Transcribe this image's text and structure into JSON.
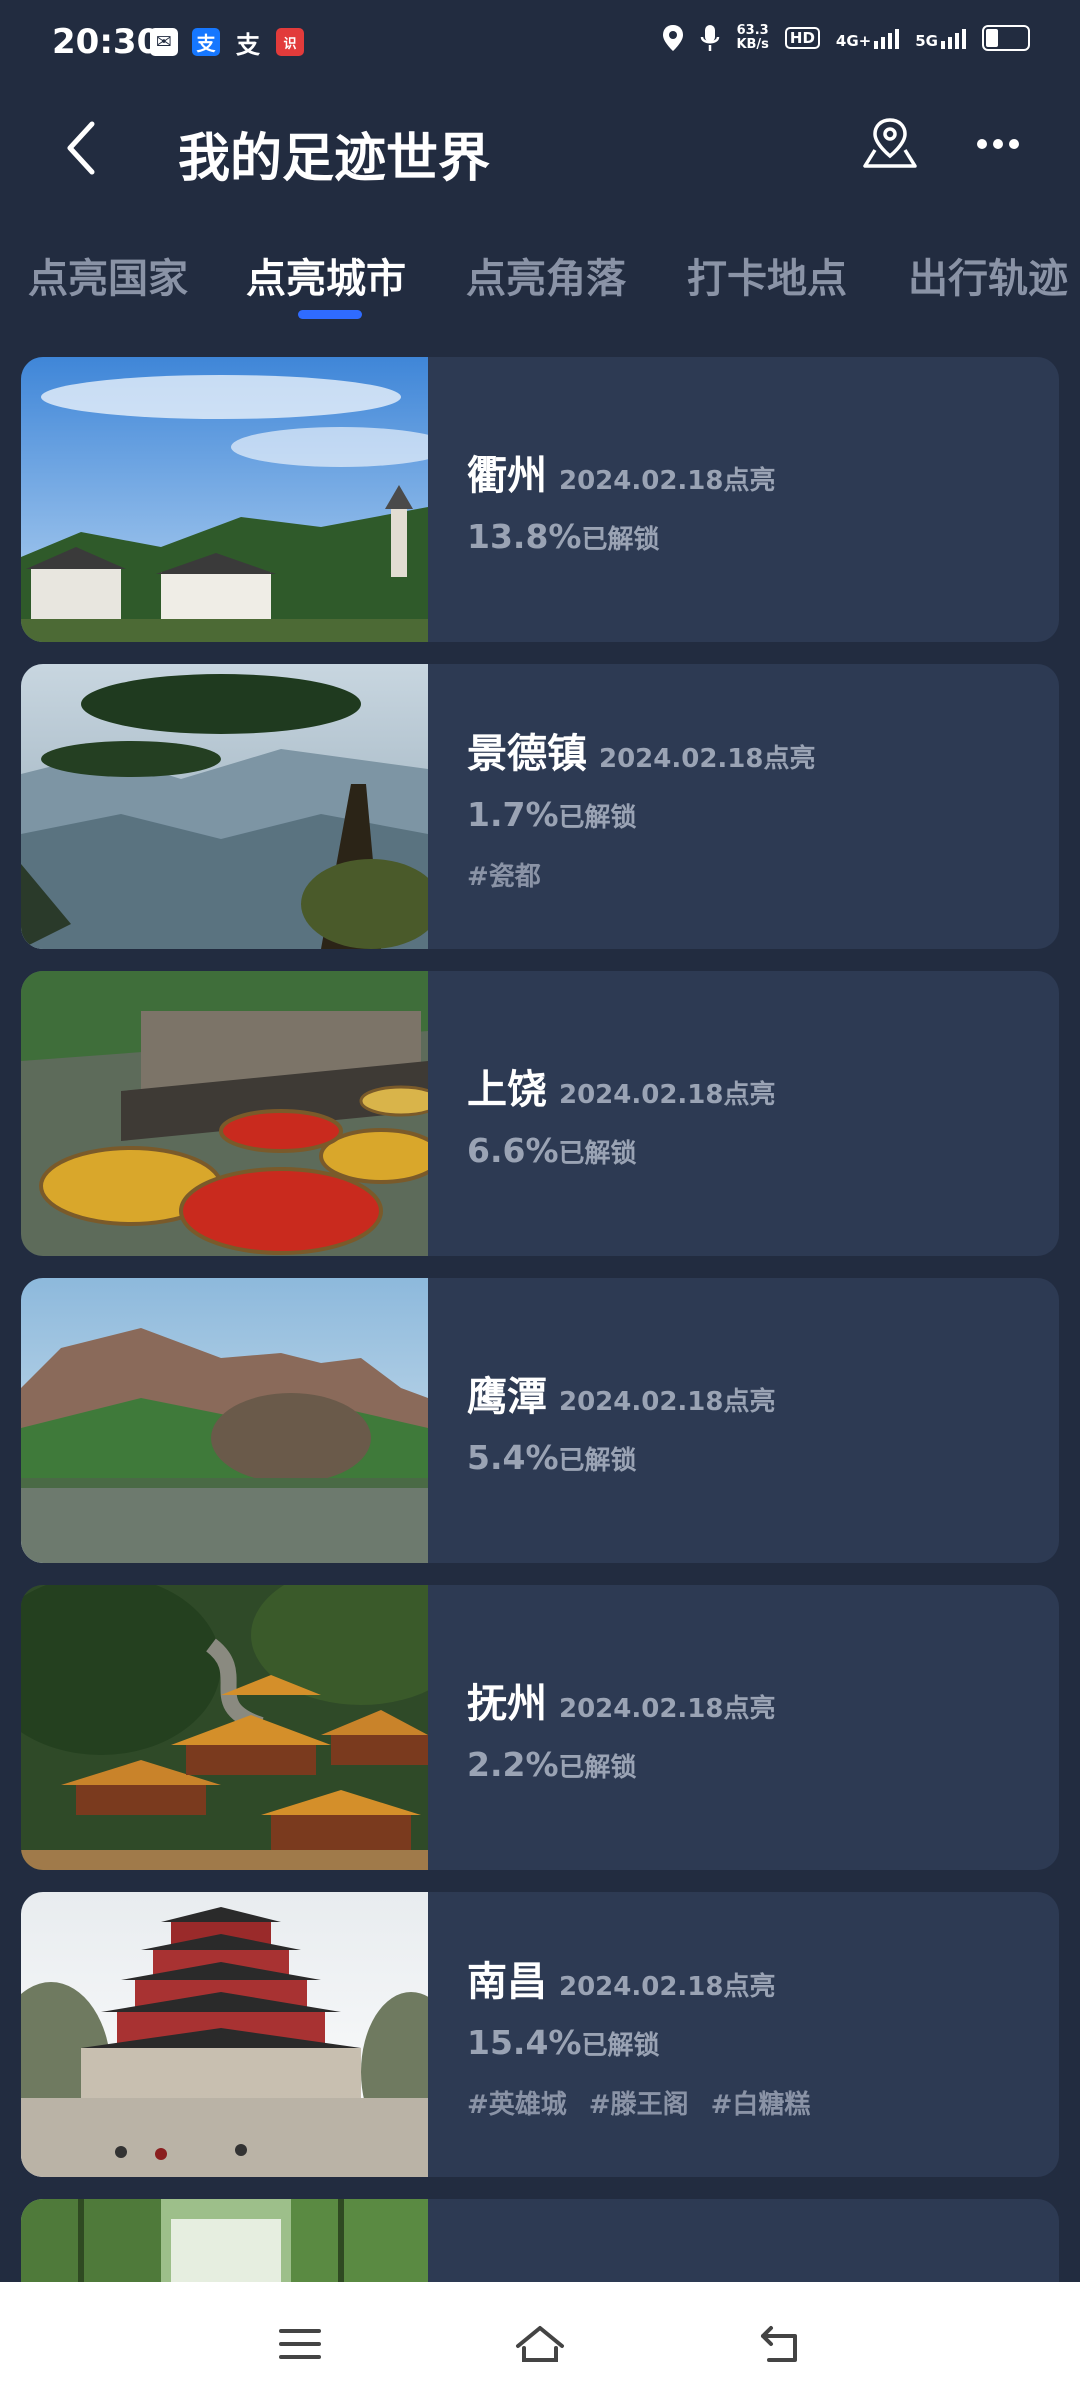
{
  "status_bar": {
    "time": "20:30",
    "notif_icons": [
      "mail-icon",
      "alipay-icon",
      "alipay-outline-icon",
      "red-app-icon"
    ],
    "notif_red_label": "识",
    "network_speed_value": "63.3",
    "network_speed_unit": "KB/s",
    "hd_label": "HD",
    "net1_label": "4G+",
    "net2_label": "5G"
  },
  "header": {
    "title": "我的足迹世界"
  },
  "tabs": [
    {
      "label": "点亮国家",
      "active": false
    },
    {
      "label": "点亮城市",
      "active": true
    },
    {
      "label": "点亮角落",
      "active": false
    },
    {
      "label": "打卡地点",
      "active": false
    },
    {
      "label": "出行轨迹",
      "active": false
    }
  ],
  "cities": [
    {
      "name": "衢州",
      "date": "2024.02.18点亮",
      "percent": "13.8%",
      "unlocked_label": "已解锁",
      "tags": []
    },
    {
      "name": "景德镇",
      "date": "2024.02.18点亮",
      "percent": "1.7%",
      "unlocked_label": "已解锁",
      "tags": [
        "#瓷都"
      ]
    },
    {
      "name": "上饶",
      "date": "2024.02.18点亮",
      "percent": "6.6%",
      "unlocked_label": "已解锁",
      "tags": []
    },
    {
      "name": "鹰潭",
      "date": "2024.02.18点亮",
      "percent": "5.4%",
      "unlocked_label": "已解锁",
      "tags": []
    },
    {
      "name": "抚州",
      "date": "2024.02.18点亮",
      "percent": "2.2%",
      "unlocked_label": "已解锁",
      "tags": []
    },
    {
      "name": "南昌",
      "date": "2024.02.18点亮",
      "percent": "15.4%",
      "unlocked_label": "已解锁",
      "tags": [
        "#英雄城",
        "#滕王阁",
        "#白糖糕"
      ]
    }
  ],
  "colors": {
    "background": "#222c40",
    "card": "#2d3a53",
    "accent": "#2f6bff",
    "muted_text": "#9aa3b4"
  },
  "nav_icons": [
    "menu-icon",
    "home-icon",
    "back-nav-icon"
  ]
}
